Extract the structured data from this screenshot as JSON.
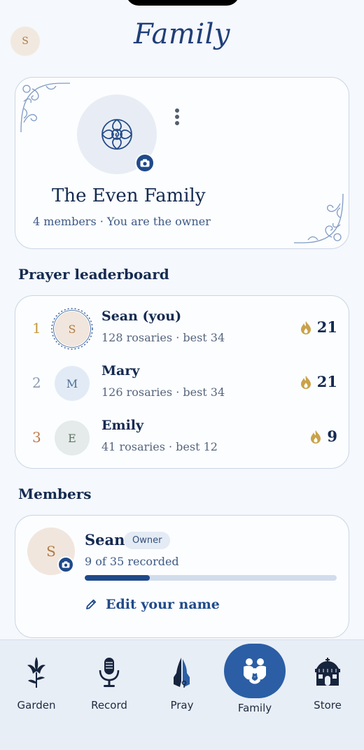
{
  "header": {
    "avatar_initial": "S",
    "title": "Family"
  },
  "family": {
    "name": "The Even Family",
    "subtitle": "4 members · You are the owner"
  },
  "leaderboard": {
    "title": "Prayer leaderboard",
    "rows": [
      {
        "rank": "1",
        "initial": "S",
        "name": "Sean (you)",
        "stats": "128 rosaries · best 34",
        "streak": "21",
        "rank_color": "#c39a3e"
      },
      {
        "rank": "2",
        "initial": "M",
        "name": "Mary",
        "stats": "126 rosaries · best 34",
        "streak": "21",
        "rank_color": "#8a9bb1"
      },
      {
        "rank": "3",
        "initial": "E",
        "name": "Emily",
        "stats": "41 rosaries · best 12",
        "streak": "9",
        "rank_color": "#c0794a"
      }
    ]
  },
  "members": {
    "title": "Members",
    "items": [
      {
        "initial": "S",
        "name": "Sean",
        "badge": "Owner",
        "progress_text": "9 of 35 recorded",
        "progress_fraction": 0.2571,
        "edit_label": "Edit your name"
      }
    ]
  },
  "tabbar": {
    "tabs": [
      {
        "label": "Garden",
        "icon": "lily-icon"
      },
      {
        "label": "Record",
        "icon": "microphone-icon"
      },
      {
        "label": "Pray",
        "icon": "praying-hands-icon"
      },
      {
        "label": "Family",
        "icon": "family-icon",
        "active": true
      },
      {
        "label": "Store",
        "icon": "store-icon"
      }
    ]
  },
  "colors": {
    "accent": "#1f4a8a",
    "active_tab": "#2b5ea5",
    "flame": "#c9a24a"
  }
}
